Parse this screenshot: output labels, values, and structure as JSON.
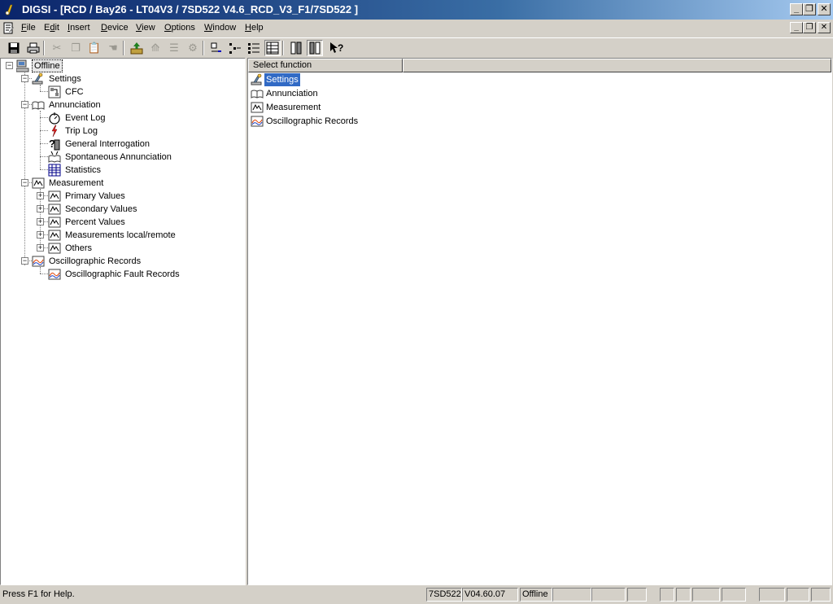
{
  "window": {
    "title": "DIGSI - [RCD / Bay26 - LT04V3 / 7SD522 V4.6_RCD_V3_F1/7SD522 ]",
    "app_icon": "digsi-icon",
    "controls": {
      "minimize": "_",
      "restore": "❐",
      "close": "✕"
    }
  },
  "menu": {
    "items": [
      {
        "pre": "",
        "mn": "F",
        "post": "ile"
      },
      {
        "pre": "E",
        "mn": "d",
        "post": "it"
      },
      {
        "pre": "",
        "mn": "I",
        "post": "nsert"
      },
      {
        "pre": "",
        "mn": "D",
        "post": "evice"
      },
      {
        "pre": "",
        "mn": "V",
        "post": "iew"
      },
      {
        "pre": "",
        "mn": "O",
        "post": "ptions"
      },
      {
        "pre": "",
        "mn": "W",
        "post": "indow"
      },
      {
        "pre": "",
        "mn": "H",
        "post": "elp"
      }
    ]
  },
  "toolbar": {
    "buttons": [
      "save-icon",
      "print-icon",
      "cut-icon",
      "copy-icon",
      "paste-icon",
      "properties-icon",
      "upload-icon",
      "export-icon",
      "align-icon",
      "tools-icon",
      "large-icons-icon",
      "small-icons-icon",
      "list-view-icon",
      "details-view-icon",
      "split-view-icon",
      "split-toggle-icon",
      "help-icon"
    ],
    "pressed": [
      "details-view-icon",
      "split-toggle-icon"
    ]
  },
  "tree": {
    "root": "Offline",
    "settings": {
      "label": "Settings",
      "children": [
        "CFC"
      ]
    },
    "annunciation": {
      "label": "Annunciation",
      "children": [
        "Event Log",
        "Trip Log",
        "General Interrogation",
        "Spontaneous Annunciation",
        "Statistics"
      ]
    },
    "measurement": {
      "label": "Measurement",
      "children": [
        "Primary Values",
        "Secondary Values",
        "Percent Values",
        "Measurements local/remote",
        "Others"
      ]
    },
    "oscillographic": {
      "label": "Oscillographic Records",
      "children": [
        "Oscillographic Fault Records"
      ]
    }
  },
  "list": {
    "column_header": "Select function",
    "items": [
      "Settings",
      "Annunciation",
      "Measurement",
      "Oscillographic Records"
    ],
    "selected": "Settings"
  },
  "status": {
    "help_text": "Press F1 for Help.",
    "device": "7SD522",
    "version": "V04.60.07",
    "mode": "Offline"
  }
}
